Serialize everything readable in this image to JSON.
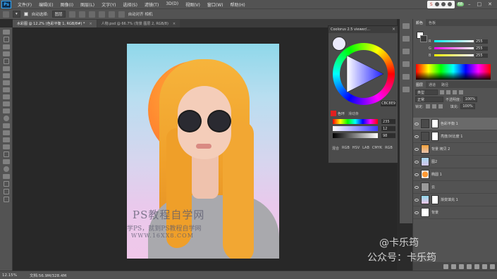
{
  "app": {
    "logo": "Ps"
  },
  "menu": [
    "文件(F)",
    "编辑(E)",
    "图像(I)",
    "图层(L)",
    "文字(Y)",
    "选择(S)",
    "滤镜(T)",
    "3D(D)",
    "视图(V)",
    "窗口(W)",
    "帮助(H)"
  ],
  "systray": {
    "ime": "S",
    "net": "68"
  },
  "options": {
    "mode": "图层",
    "auto_select": "自动选择:",
    "auto_align_label": "自动对齐 相机"
  },
  "tabs": [
    {
      "label": "水彩图 @ 12.2% (色彩平衡 1, RGB/8#) *",
      "active": true
    },
    {
      "label": "人物.psd @ 66.7% (背景 图层 2, RGB/8)",
      "active": false
    }
  ],
  "watermark": {
    "title": "PS教程自学网",
    "line1": "学PS，就到PS教程自学网",
    "line2": "WWW.16XX8.COM",
    "author_handle": "@卡乐筠",
    "account": "公众号：卡乐筠"
  },
  "color_panel": {
    "title": "Coolorus 2.5 viewer/...",
    "hex": "CBC8E9",
    "tab_active": "色环",
    "tab_other": "滑动条",
    "sliders": [
      {
        "value": "235"
      },
      {
        "value": "12"
      },
      {
        "value": "98"
      }
    ],
    "modes": [
      "混合",
      "RGB",
      "HSV",
      "LAB",
      "CMYK",
      "RGB"
    ]
  },
  "right_panels": {
    "color_tabs": [
      "颜色",
      "色板"
    ],
    "rgb": [
      {
        "label": "R",
        "value": "255"
      },
      {
        "label": "G",
        "value": "255"
      },
      {
        "label": "B",
        "value": "255"
      }
    ],
    "layer_tabs": [
      "图层",
      "通道",
      "路径"
    ],
    "kind": "类型",
    "blend": "正常",
    "opacity_label": "不透明度:",
    "opacity": "100%",
    "lock_label": "锁定:",
    "fill_label": "填充:",
    "fill": "100%",
    "layers": [
      {
        "name": "色彩平衡 1",
        "selected": true
      },
      {
        "name": "亮度/对比度 1",
        "selected": false
      },
      {
        "name": "背景 拷贝 2",
        "selected": false
      },
      {
        "name": "图2",
        "selected": false
      },
      {
        "name": "椭圆 1",
        "selected": false
      },
      {
        "name": "云",
        "selected": false
      },
      {
        "name": "渐变填充 1",
        "selected": false
      },
      {
        "name": "背景",
        "selected": false
      }
    ]
  },
  "status": {
    "zoom": "12.15%",
    "doc": "文档:56.9M/328.4M"
  }
}
